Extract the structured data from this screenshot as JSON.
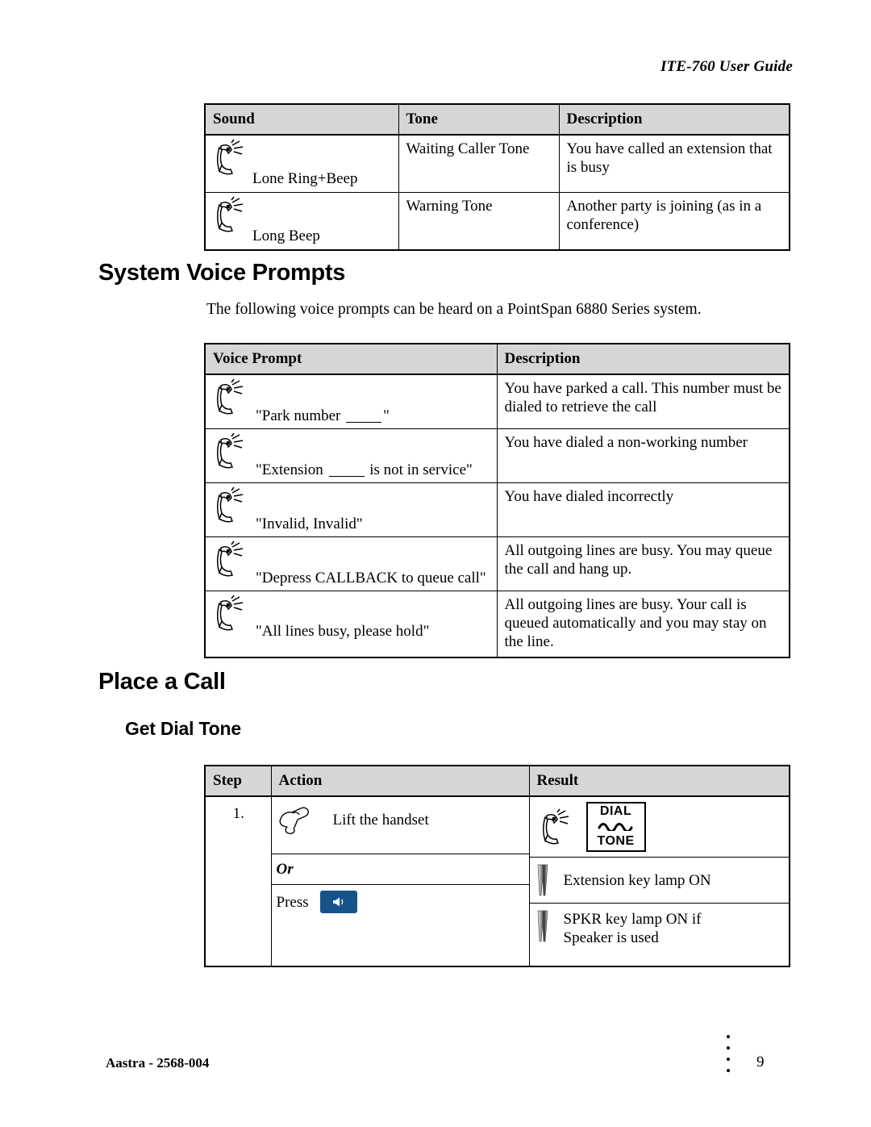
{
  "header": {
    "running_title": "ITE-760 User Guide"
  },
  "tone_table": {
    "name": "sound-tone-table",
    "columns": [
      "Sound",
      "Tone",
      "Description"
    ],
    "rows": [
      {
        "icon": "handset-ringing-icon",
        "sound": "Lone Ring+Beep",
        "tone": "Waiting Caller Tone",
        "description": "You have called an extension that is busy"
      },
      {
        "icon": "handset-ringing-icon",
        "sound": "Long Beep",
        "tone": "Warning Tone",
        "description": "Another party is joining (as in a conference)"
      }
    ]
  },
  "voice_prompts_section": {
    "heading": "System Voice Prompts",
    "intro": "The following voice prompts can be heard on a PointSpan 6880 Series system."
  },
  "voice_prompt_table": {
    "name": "voice-prompt-table",
    "columns": [
      "Voice Prompt",
      "Description"
    ],
    "rows": [
      {
        "icon": "handset-ringing-icon",
        "prompt_pre": "\"Park number ",
        "prompt_post": "\"",
        "has_blank": true,
        "description": "You have parked a call.  This number must be dialed to retrieve the call"
      },
      {
        "icon": "handset-ringing-icon",
        "prompt_pre": "\"Extension ",
        "prompt_post": " is not in service\"",
        "has_blank": true,
        "description": "You have dialed a non-working number"
      },
      {
        "icon": "handset-ringing-icon",
        "prompt_pre": "\"Invalid, Invalid\"",
        "prompt_post": "",
        "has_blank": false,
        "description": "You have dialed incorrectly"
      },
      {
        "icon": "handset-ringing-icon",
        "prompt_pre": "\"Depress CALLBACK to queue call\"",
        "prompt_post": "",
        "has_blank": false,
        "description": "All outgoing lines are busy.  You may queue the call and hang up."
      },
      {
        "icon": "handset-ringing-icon",
        "prompt_pre": "\"All lines busy, please hold\"",
        "prompt_post": "",
        "has_blank": false,
        "description": "All outgoing lines are busy.  Your call is queued automatically and you may stay on the line."
      }
    ]
  },
  "place_call_section": {
    "heading": "Place a Call",
    "subheading": "Get Dial Tone"
  },
  "step_table": {
    "name": "get-dial-tone-step-table",
    "columns": [
      "Step",
      "Action",
      "Result"
    ],
    "step_number": "1.",
    "actions": [
      {
        "icon": "lift-handset-icon",
        "label": "Lift the handset"
      },
      {
        "icon": "",
        "label": "Or",
        "italic": true
      },
      {
        "icon": "",
        "label": "Press",
        "button_icon": "speaker-icon",
        "button_color": "#16538a"
      }
    ],
    "results": [
      {
        "icon": "handset-ringing-icon",
        "badge": {
          "top": "DIAL",
          "wave": "~~~",
          "bottom": "TONE"
        },
        "label": ""
      },
      {
        "icon": "key-lamp-icon",
        "label": "Extension key lamp ON"
      },
      {
        "icon": "key-lamp-icon",
        "label": "SPKR key lamp ON if Speaker is used"
      }
    ]
  },
  "footer": {
    "left": "Aastra - 2568-004",
    "page_number": "9"
  },
  "colors": {
    "table_header_bg": "#d6d6d6",
    "speaker_button": "#16538a",
    "rule": "#000000"
  }
}
